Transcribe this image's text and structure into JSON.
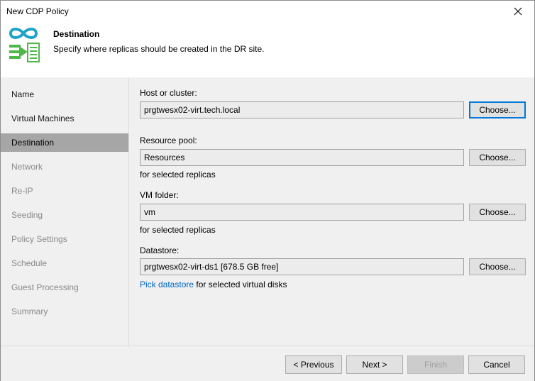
{
  "window": {
    "title": "New CDP Policy"
  },
  "header": {
    "title": "Destination",
    "subtitle": "Specify where replicas should be created in the DR site."
  },
  "sidebar": {
    "items": [
      {
        "label": "Name",
        "state": "enabled"
      },
      {
        "label": "Virtual Machines",
        "state": "enabled"
      },
      {
        "label": "Destination",
        "state": "active"
      },
      {
        "label": "Network",
        "state": "disabled"
      },
      {
        "label": "Re-IP",
        "state": "disabled"
      },
      {
        "label": "Seeding",
        "state": "disabled"
      },
      {
        "label": "Policy Settings",
        "state": "disabled"
      },
      {
        "label": "Schedule",
        "state": "disabled"
      },
      {
        "label": "Guest Processing",
        "state": "disabled"
      },
      {
        "label": "Summary",
        "state": "disabled"
      }
    ]
  },
  "form": {
    "host": {
      "label": "Host or cluster:",
      "value": "prgtwesx02-virt.tech.local",
      "button": "Choose..."
    },
    "pool": {
      "label": "Resource pool:",
      "value": "Resources",
      "button": "Choose...",
      "note": "for selected replicas"
    },
    "folder": {
      "label": "VM folder:",
      "value": "vm",
      "button": "Choose...",
      "note": "for selected replicas"
    },
    "datastore": {
      "label": "Datastore:",
      "value": "prgtwesx02-virt-ds1 [678.5 GB free]",
      "button": "Choose...",
      "link": "Pick datastore",
      "note": "for selected virtual disks"
    }
  },
  "footer": {
    "previous": "< Previous",
    "next": "Next >",
    "finish": "Finish",
    "cancel": "Cancel"
  },
  "colors": {
    "accent": "#0078d7",
    "logo_teal": "#1fa3c9",
    "logo_green": "#4db848",
    "link": "#0066cc"
  },
  "icons": [
    "close-icon",
    "cdp-policy-wizard-icon"
  ]
}
